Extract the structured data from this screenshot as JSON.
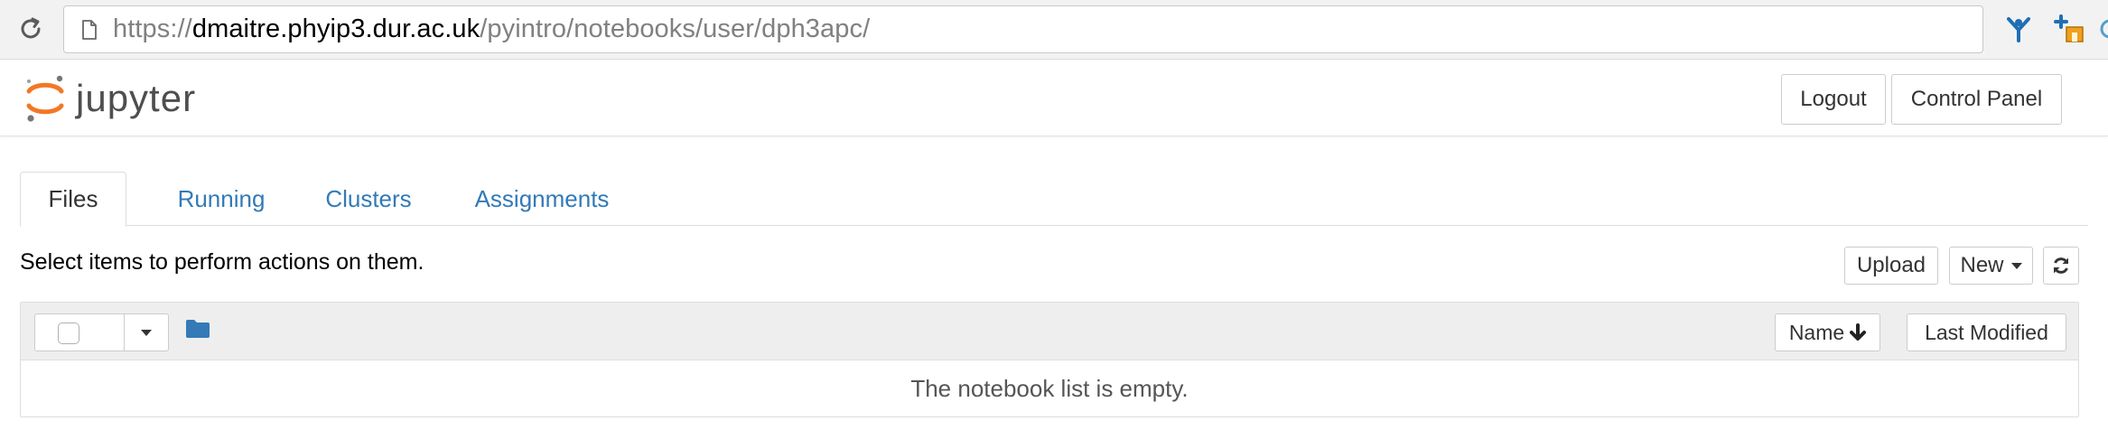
{
  "browser": {
    "url_scheme": "https://",
    "url_host": "dmaitre.phyip3.dur.ac.uk",
    "url_path": "/pyintro/notebooks/user/dph3apc/",
    "icons": [
      "reload-icon",
      "page-icon",
      "extension-icon",
      "extension-icon",
      "extension-icon"
    ]
  },
  "header": {
    "logo_text": "jupyter",
    "logout_label": "Logout",
    "control_panel_label": "Control Panel"
  },
  "tabs": [
    {
      "label": "Files",
      "active": true
    },
    {
      "label": "Running",
      "active": false
    },
    {
      "label": "Clusters",
      "active": false
    },
    {
      "label": "Assignments",
      "active": false
    }
  ],
  "toolbar": {
    "hint": "Select items to perform actions on them.",
    "upload_label": "Upload",
    "new_label": "New"
  },
  "file_list": {
    "sort_name_label": "Name",
    "sort_modified_label": "Last Modified",
    "empty_message": "The notebook list is empty."
  },
  "colors": {
    "link": "#337ab7",
    "jupyter_orange": "#f37726",
    "folder": "#337ab7"
  }
}
